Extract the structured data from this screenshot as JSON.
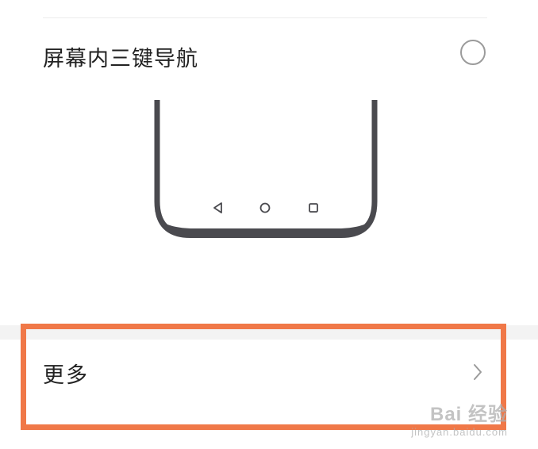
{
  "option": {
    "label": "屏幕内三键导航",
    "selected": false
  },
  "preview": {
    "buttons": [
      "back-icon",
      "home-icon",
      "recents-icon"
    ],
    "frame_color": "#4a4a4f"
  },
  "more": {
    "label": "更多"
  },
  "highlight": {
    "color": "#f07848"
  },
  "watermark": {
    "brand": "Bai 经验",
    "url": "jingyan.baidu.com"
  }
}
